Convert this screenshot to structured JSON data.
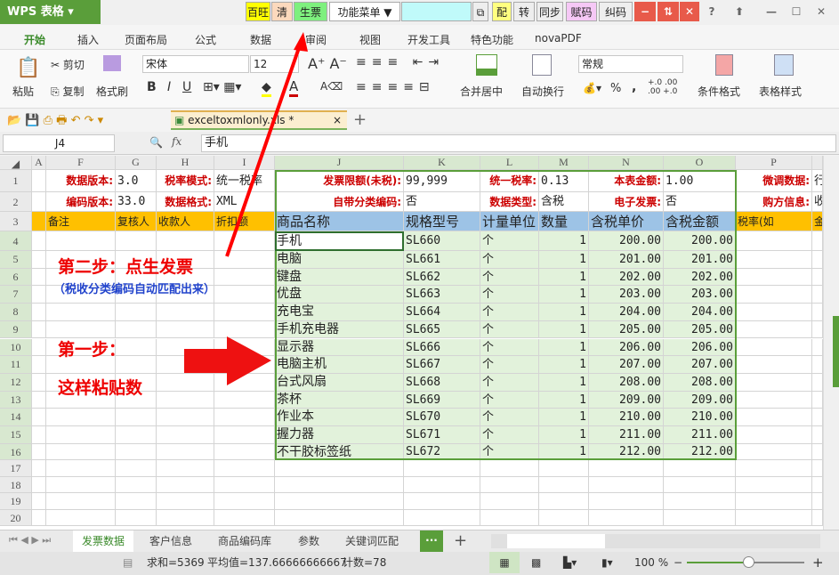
{
  "app": {
    "title": "WPS 表格"
  },
  "quickbar": [
    {
      "label": "百旺",
      "bg": "#ffff00"
    },
    {
      "label": "清",
      "bg": "#fcd9bd"
    },
    {
      "label": "生票",
      "bg": "#7ef07e"
    },
    {
      "label": "功能菜单 ▼",
      "bg": "#ffffff"
    },
    {
      "label": "",
      "bg": "#c0fafa"
    },
    {
      "label": "⧉",
      "bg": "#eeeeee"
    },
    {
      "label": "配",
      "bg": "#ffff80"
    },
    {
      "label": "转",
      "bg": "#eeeeee"
    },
    {
      "label": "同步",
      "bg": "#eeeeee"
    },
    {
      "label": "赋码",
      "bg": "#f6c8f6"
    },
    {
      "label": "纠码",
      "bg": "#eeeeee"
    }
  ],
  "window_controls": [
    "−",
    "⇅",
    "✕",
    "?",
    "⬆",
    "—",
    "☐",
    "✕"
  ],
  "menu_tabs": [
    "开始",
    "插入",
    "页面布局",
    "公式",
    "数据",
    "审阅",
    "视图",
    "开发工具",
    "特色功能",
    "novaPDF"
  ],
  "ribbon": {
    "paste": "粘贴",
    "cut": "剪切",
    "copy": "复制",
    "format_painter": "格式刷",
    "font": "宋体",
    "size": "12",
    "bold": "B",
    "italic": "I",
    "underline": "U",
    "merge_center": "合并居中",
    "wrap": "自动换行",
    "number_format": "常规",
    "percent": "%",
    "comma": ",",
    "cond_format": "条件格式",
    "table_style": "表格样式"
  },
  "file_tab": {
    "name": "exceltoxmlonly.xls *",
    "close": "×",
    "add": "+"
  },
  "formula_bar": {
    "cell_ref": "J4",
    "fx": "fx",
    "value": "手机"
  },
  "columns": [
    "A",
    "F",
    "G",
    "H",
    "I",
    "J",
    "K",
    "L",
    "M",
    "N",
    "O",
    "P",
    ""
  ],
  "row_numbers": [
    "1",
    "2",
    "3",
    "4",
    "5",
    "6",
    "7",
    "8",
    "9",
    "10",
    "11",
    "12",
    "13",
    "14",
    "15",
    "16",
    "17",
    "18",
    "19",
    "20"
  ],
  "row1": [
    "",
    "数据版本:",
    "3.0",
    "税率模式:",
    "统一税率",
    "发票限额(未税):",
    "99,999",
    "统一税率:",
    "0.13",
    "本表金额:",
    "1.00",
    "微调数据:",
    "行"
  ],
  "row2": [
    "",
    "编码版本:",
    "33.0",
    "数据格式:",
    "XML",
    "自带分类编码:",
    "否",
    "数据类型:",
    "含税",
    "电子发票:",
    "否",
    "购方信息:",
    "收"
  ],
  "row3": [
    "",
    "备注",
    "复核人",
    "收款人",
    "折扣额",
    "商品名称",
    "规格型号",
    "计量单位",
    "数量",
    "含税单价",
    "含税金额",
    "税率(如",
    "金"
  ],
  "items": [
    [
      "手机",
      "SL660",
      "个",
      "1",
      "200.00",
      "200.00"
    ],
    [
      "电脑",
      "SL661",
      "个",
      "1",
      "201.00",
      "201.00"
    ],
    [
      "键盘",
      "SL662",
      "个",
      "1",
      "202.00",
      "202.00"
    ],
    [
      "优盘",
      "SL663",
      "个",
      "1",
      "203.00",
      "203.00"
    ],
    [
      "充电宝",
      "SL664",
      "个",
      "1",
      "204.00",
      "204.00"
    ],
    [
      "手机充电器",
      "SL665",
      "个",
      "1",
      "205.00",
      "205.00"
    ],
    [
      "显示器",
      "SL666",
      "个",
      "1",
      "206.00",
      "206.00"
    ],
    [
      "电脑主机",
      "SL667",
      "个",
      "1",
      "207.00",
      "207.00"
    ],
    [
      "台式风扇",
      "SL668",
      "个",
      "1",
      "208.00",
      "208.00"
    ],
    [
      "茶杯",
      "SL669",
      "个",
      "1",
      "209.00",
      "209.00"
    ],
    [
      "作业本",
      "SL670",
      "个",
      "1",
      "210.00",
      "210.00"
    ],
    [
      "握力器",
      "SL671",
      "个",
      "1",
      "211.00",
      "211.00"
    ],
    [
      "不干胶标签纸",
      "SL672",
      "个",
      "1",
      "212.00",
      "212.00"
    ]
  ],
  "annotations": {
    "step2": "第二步：点生发票",
    "step2_sub": "（税收分类编码自动匹配出来）",
    "step1": "第一步：",
    "step1_sub": "这样粘贴数"
  },
  "sheet_tabs": [
    "发票数据",
    "客户信息",
    "商品编码库",
    "参数",
    "关键词匹配"
  ],
  "sheet_more": "···",
  "sheet_add": "+",
  "status": {
    "sum": "求和=5369",
    "avg": "平均值=137.66666666667",
    "count": "计数=78",
    "zoom": "100 %"
  },
  "colors": {
    "accent": "#5a9e3a",
    "label_red": "#c00000",
    "header_yellow": "#ffc000",
    "header_blue": "#9dc3e6",
    "data_green": "#e2f2db"
  }
}
